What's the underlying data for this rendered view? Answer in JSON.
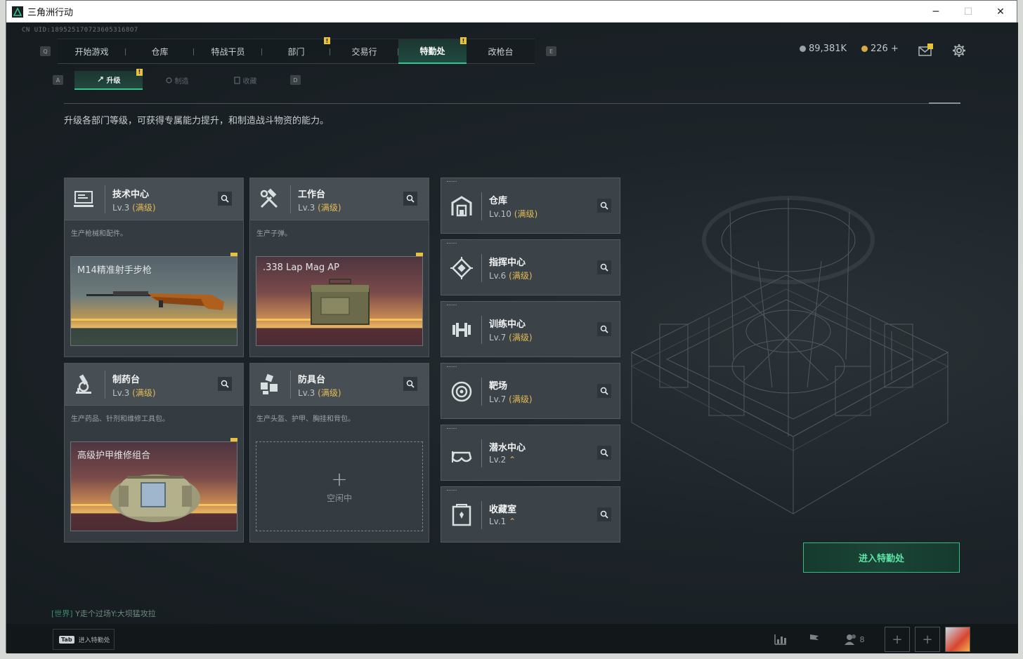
{
  "window": {
    "title": "三角洲行动",
    "minimize": "─",
    "maximize": "☐",
    "close": "✕"
  },
  "uid": "CN UID:1895251707236053168O7",
  "nav": {
    "left_key": "Q",
    "right_key": "E",
    "tabs": [
      {
        "label": "开始游戏",
        "active": false,
        "badge": false
      },
      {
        "label": "仓库",
        "active": false,
        "badge": false
      },
      {
        "label": "特战干员",
        "active": false,
        "badge": false
      },
      {
        "label": "部门",
        "active": false,
        "badge": true
      },
      {
        "label": "交易行",
        "active": false,
        "badge": false
      },
      {
        "label": "特勤处",
        "active": true,
        "badge": true
      },
      {
        "label": "改枪台",
        "active": false,
        "badge": false
      }
    ],
    "badge_text": "!"
  },
  "currency": {
    "coins": "89,381K",
    "points": "226 +"
  },
  "subnav": {
    "left_key": "A",
    "right_key": "D",
    "tabs": [
      {
        "label": "升级",
        "active": true
      },
      {
        "label": "制造",
        "active": false
      },
      {
        "label": "收藏",
        "active": false
      }
    ]
  },
  "description": "升级各部门等级，可获得专属能力提升，和制造战斗物资的能力。",
  "workstations": [
    {
      "name": "技术中心",
      "level": "Lv.3",
      "max": "(满级)",
      "desc": "生产枪械和配件。",
      "item": "M14精准射手步枪",
      "icon": "computer-icon"
    },
    {
      "name": "工作台",
      "level": "Lv.3",
      "max": "(满级)",
      "desc": "生产子弹。",
      "item": ".338 Lap Mag AP",
      "icon": "hammer-wrench-icon"
    },
    {
      "name": "制药台",
      "level": "Lv.3",
      "max": "(满级)",
      "desc": "生产药品、针剂和维修工具包。",
      "item": "高级护甲维修组合",
      "icon": "microscope-icon"
    },
    {
      "name": "防具台",
      "level": "Lv.3",
      "max": "(满级)",
      "desc": "生产头盔、护甲、胸挂和背包。",
      "idle": "空闲中",
      "icon": "armor-parts-icon"
    }
  ],
  "facilities": [
    {
      "name": "仓库",
      "level": "Lv.10",
      "max": "(满级)",
      "icon": "warehouse-icon"
    },
    {
      "name": "指挥中心",
      "level": "Lv.6",
      "max": "(满级)",
      "icon": "command-icon"
    },
    {
      "name": "训练中心",
      "level": "Lv.7",
      "max": "(满级)",
      "icon": "dumbbell-icon"
    },
    {
      "name": "靶场",
      "level": "Lv.7",
      "max": "(满级)",
      "icon": "target-icon"
    },
    {
      "name": "潜水中心",
      "level": "Lv.2",
      "max": "",
      "upgradable": true,
      "icon": "diving-mask-icon"
    },
    {
      "name": "收藏室",
      "level": "Lv.1",
      "max": "",
      "upgradable": true,
      "icon": "collection-icon"
    }
  ],
  "enter_button": "进入特勤处",
  "chat": {
    "channel": "[世界]",
    "message": "Y走个过场Y:大坝猛攻拉"
  },
  "bottom": {
    "tab_key": "Tab",
    "tab_label": "进入特勤处",
    "friends_count": "8",
    "add": "+"
  },
  "colors": {
    "accent": "#34c58d",
    "gold": "#e2bb55",
    "badge": "#e8c23c"
  }
}
